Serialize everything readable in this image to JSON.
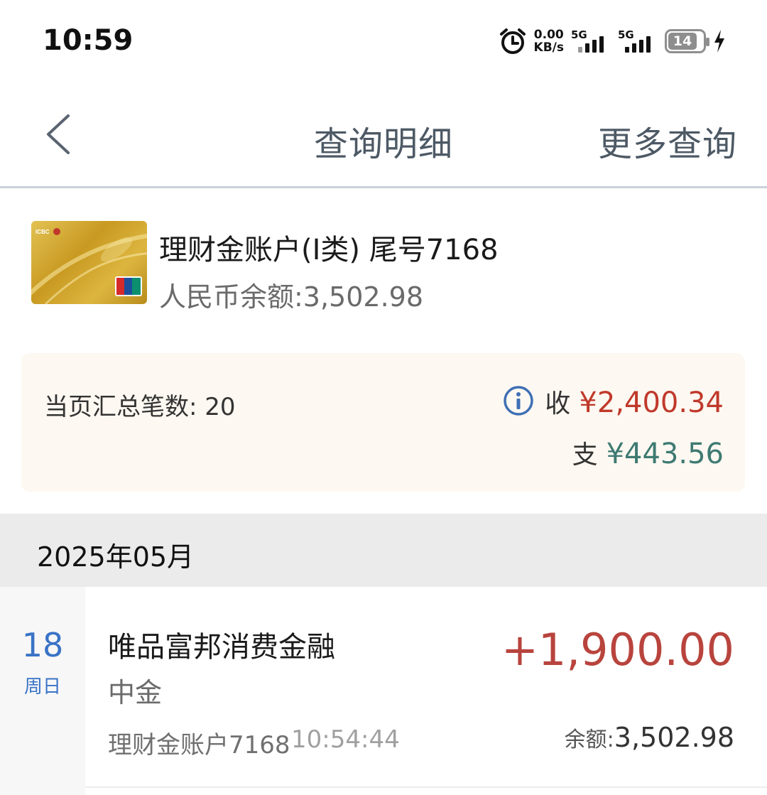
{
  "status_bar": {
    "time": "10:59",
    "speed_value": "0.00",
    "speed_unit": "KB/s",
    "signal1_label": "5G",
    "signal2_label": "5G",
    "battery": "14"
  },
  "nav": {
    "title": "查询明细",
    "more": "更多查询"
  },
  "account": {
    "name": "理财金账户(Ⅰ类) 尾号7168",
    "balance": "人民币余额:3,502.98"
  },
  "summary": {
    "count": "当页汇总笔数: 20",
    "income_label": "收",
    "income_amount": "¥2,400.34",
    "expense_label": "支",
    "expense_amount": "¥443.56",
    "income_color": "#c0392b",
    "expense_color": "#3d7a72"
  },
  "month": "2025年05月",
  "transactions": [
    {
      "day": "18",
      "weekday": "周日",
      "merchant": "唯品富邦消费金融",
      "counterparty": "中金",
      "amount": "+1,900.00",
      "account": "理财金账户7168",
      "time": "10:54:44",
      "balance_label": "余额:",
      "balance": "3,502.98"
    }
  ],
  "colors": {
    "accent_blue": "#3973c6",
    "nav_text": "#4d5965"
  }
}
